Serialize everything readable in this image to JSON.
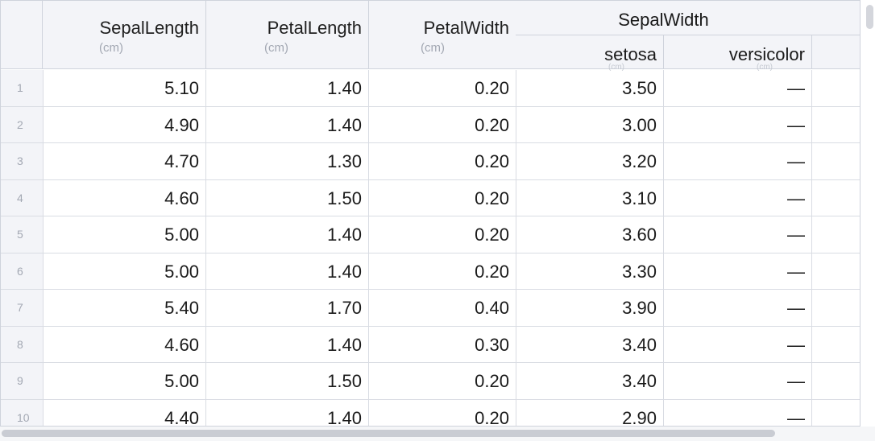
{
  "columns": {
    "sepal_length": {
      "label": "SepalLength",
      "unit": "(cm)"
    },
    "petal_length": {
      "label": "PetalLength",
      "unit": "(cm)"
    },
    "petal_width": {
      "label": "PetalWidth",
      "unit": "(cm)"
    },
    "sepal_width": {
      "label": "SepalWidth",
      "sub": [
        "setosa",
        "versicolor"
      ],
      "sub_units": [
        "(cm)",
        "(cm)"
      ]
    }
  },
  "rows": [
    {
      "n": "1",
      "sl": "5.10",
      "pl": "1.40",
      "pw": "0.20",
      "sw_setosa": "3.50",
      "sw_versicolor": "—"
    },
    {
      "n": "2",
      "sl": "4.90",
      "pl": "1.40",
      "pw": "0.20",
      "sw_setosa": "3.00",
      "sw_versicolor": "—"
    },
    {
      "n": "3",
      "sl": "4.70",
      "pl": "1.30",
      "pw": "0.20",
      "sw_setosa": "3.20",
      "sw_versicolor": "—"
    },
    {
      "n": "4",
      "sl": "4.60",
      "pl": "1.50",
      "pw": "0.20",
      "sw_setosa": "3.10",
      "sw_versicolor": "—"
    },
    {
      "n": "5",
      "sl": "5.00",
      "pl": "1.40",
      "pw": "0.20",
      "sw_setosa": "3.60",
      "sw_versicolor": "—"
    },
    {
      "n": "6",
      "sl": "5.00",
      "pl": "1.40",
      "pw": "0.20",
      "sw_setosa": "3.30",
      "sw_versicolor": "—"
    },
    {
      "n": "7",
      "sl": "5.40",
      "pl": "1.70",
      "pw": "0.40",
      "sw_setosa": "3.90",
      "sw_versicolor": "—"
    },
    {
      "n": "8",
      "sl": "4.60",
      "pl": "1.40",
      "pw": "0.30",
      "sw_setosa": "3.40",
      "sw_versicolor": "—"
    },
    {
      "n": "9",
      "sl": "5.00",
      "pl": "1.50",
      "pw": "0.20",
      "sw_setosa": "3.40",
      "sw_versicolor": "—"
    },
    {
      "n": "10",
      "sl": "4.40",
      "pl": "1.40",
      "pw": "0.20",
      "sw_setosa": "2.90",
      "sw_versicolor": "—"
    }
  ]
}
